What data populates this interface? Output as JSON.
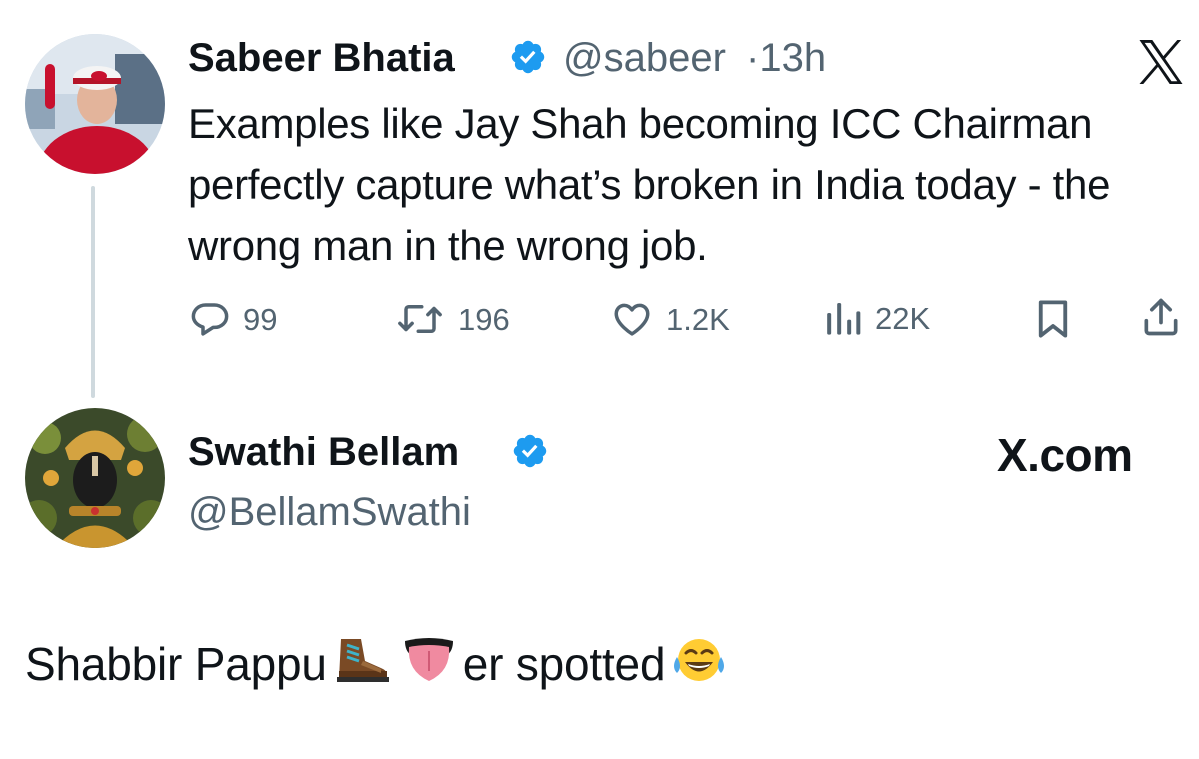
{
  "tweet": {
    "author_name": "Sabeer Bhatia",
    "handle": "@sabeer",
    "separator": "·",
    "time": "13h",
    "text": "Examples like Jay Shah becoming ICC Chairman perfectly capture what’s broken in India today - the wrong man in the wrong job.",
    "stats": {
      "replies": "99",
      "retweets": "196",
      "likes": "1.2K",
      "views": "22K"
    }
  },
  "quote": {
    "author_name": "Swathi Bellam",
    "handle": "@BellamSwathi",
    "brand": "X.com",
    "caption_part1": "Shabbir Pappu",
    "caption_part2": "er spotted"
  },
  "icons": {
    "verified": "verified-badge-icon",
    "x_logo": "x-logo-icon",
    "reply": "reply-icon",
    "retweet": "retweet-icon",
    "like": "heart-icon",
    "views": "views-icon",
    "bookmark": "bookmark-icon",
    "share": "share-icon",
    "boot_emoji": "hiking-boot-emoji",
    "tongue_emoji": "tongue-emoji",
    "laugh_emoji": "tears-of-joy-emoji"
  },
  "colors": {
    "text": "#0f1419",
    "secondary": "#536471",
    "verified_blue": "#1d9bf0",
    "thread_line": "#cfd9de"
  }
}
